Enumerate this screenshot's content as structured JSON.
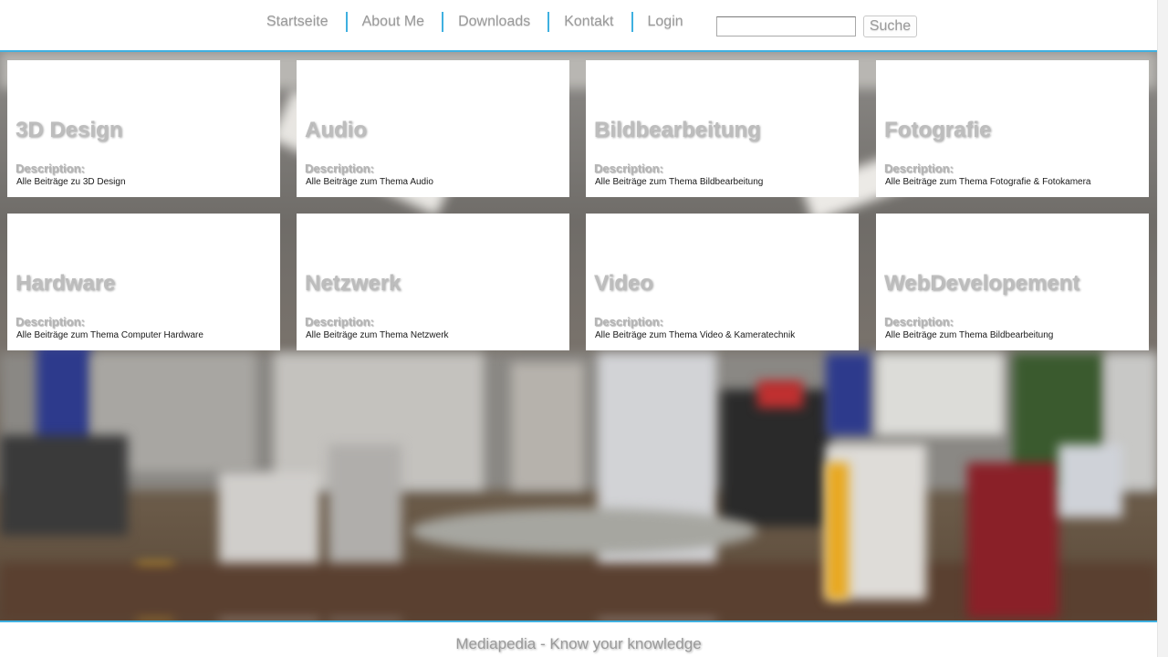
{
  "nav": {
    "items": [
      {
        "label": "Startseite"
      },
      {
        "label": "About Me"
      },
      {
        "label": "Downloads"
      },
      {
        "label": "Kontakt"
      },
      {
        "label": "Login"
      }
    ]
  },
  "search": {
    "value": "",
    "button_label": "Suche"
  },
  "desc_label": "Description:",
  "categories": [
    {
      "title": "3D Design",
      "description": "Alle Beiträge zu 3D Design"
    },
    {
      "title": "Audio",
      "description": "Alle Beiträge zum Thema Audio"
    },
    {
      "title": "Bildbearbeitung",
      "description": "Alle Beiträge zum Thema Bildbearbeitung"
    },
    {
      "title": "Fotografie",
      "description": "Alle Beiträge zum Thema Fotografie & Fotokamera"
    },
    {
      "title": "Hardware",
      "description": "Alle Beiträge zum Thema Computer Hardware"
    },
    {
      "title": "Netzwerk",
      "description": "Alle Beiträge zum Thema Netzwerk"
    },
    {
      "title": "Video",
      "description": "Alle Beiträge zum Thema Video & Kameratechnik"
    },
    {
      "title": "WebDevelopement",
      "description": "Alle Beiträge zum Thema Bildbearbeitung"
    }
  ],
  "footer": {
    "text": "Mediapedia - Know your knowledge"
  },
  "colors": {
    "accent": "#3fb0e0",
    "nav_text": "#9a9a9a",
    "card_title": "#bdbdbd"
  }
}
